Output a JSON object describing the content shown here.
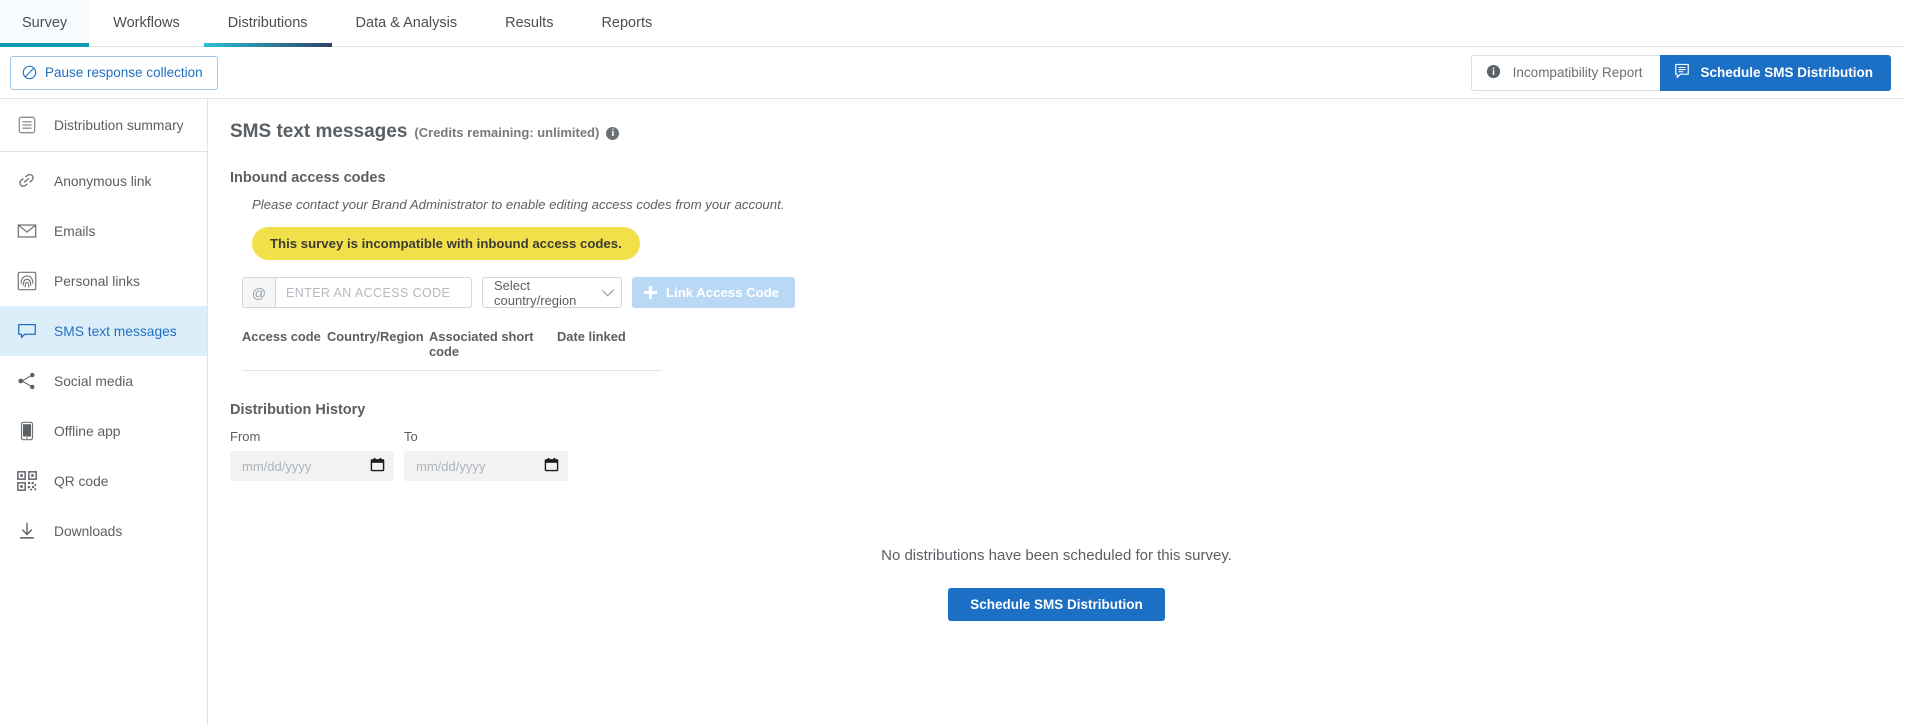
{
  "topbar": {
    "tabs": [
      {
        "label": "Survey",
        "state": "section"
      },
      {
        "label": "Workflows",
        "state": "idle"
      },
      {
        "label": "Distributions",
        "state": "active"
      },
      {
        "label": "Data & Analysis",
        "state": "idle"
      },
      {
        "label": "Results",
        "state": "idle"
      },
      {
        "label": "Reports",
        "state": "idle"
      }
    ]
  },
  "actionbar": {
    "pause_label": "Pause response collection",
    "incompatibility_label": "Incompatibility Report",
    "schedule_label": "Schedule SMS Distribution"
  },
  "sidebar": {
    "summary": {
      "label": "Distribution summary",
      "icon": "list-icon"
    },
    "items": [
      {
        "label": "Anonymous link",
        "icon": "link-icon",
        "selected": false
      },
      {
        "label": "Emails",
        "icon": "envelope-icon",
        "selected": false
      },
      {
        "label": "Personal links",
        "icon": "fingerprint-icon",
        "selected": false
      },
      {
        "label": "SMS text messages",
        "icon": "chat-bubble-icon",
        "selected": true
      },
      {
        "label": "Social media",
        "icon": "share-icon",
        "selected": false
      },
      {
        "label": "Offline app",
        "icon": "mobile-icon",
        "selected": false
      },
      {
        "label": "QR code",
        "icon": "qr-icon",
        "selected": false
      },
      {
        "label": "Downloads",
        "icon": "download-icon",
        "selected": false
      }
    ]
  },
  "main": {
    "title": "SMS text messages",
    "credits": "(Credits remaining: unlimited)",
    "info_icon": "info-icon",
    "inbound": {
      "heading": "Inbound access codes",
      "hint": "Please contact your Brand Administrator to enable editing access codes from your account.",
      "warning": "This survey is incompatible with inbound access codes.",
      "access_code_prefix": "@",
      "access_code_placeholder": "ENTER AN ACCESS CODE",
      "access_code_value": "",
      "country_selected": "Select country/region",
      "link_button": "Link Access Code",
      "table_headers": [
        "Access code",
        "Country/Region",
        "Associated short code",
        "Date linked"
      ],
      "table_rows": []
    },
    "history": {
      "heading": "Distribution History",
      "from_label": "From",
      "to_label": "To",
      "from_placeholder": "mm/dd/yyyy",
      "to_placeholder": "mm/dd/yyyy",
      "from_value": "",
      "to_value": ""
    },
    "empty": {
      "message": "No distributions have been scheduled for this survey.",
      "button": "Schedule SMS Distribution"
    }
  },
  "colors": {
    "accent_blue": "#1b6fc4",
    "selected_nav_bg": "#ddeefb",
    "warning_yellow": "#f2e04b",
    "tab_underline_teal": "#0b99ad",
    "tab_gradient_end": "#2e4369",
    "disabled_button": "#b9d8f5"
  }
}
